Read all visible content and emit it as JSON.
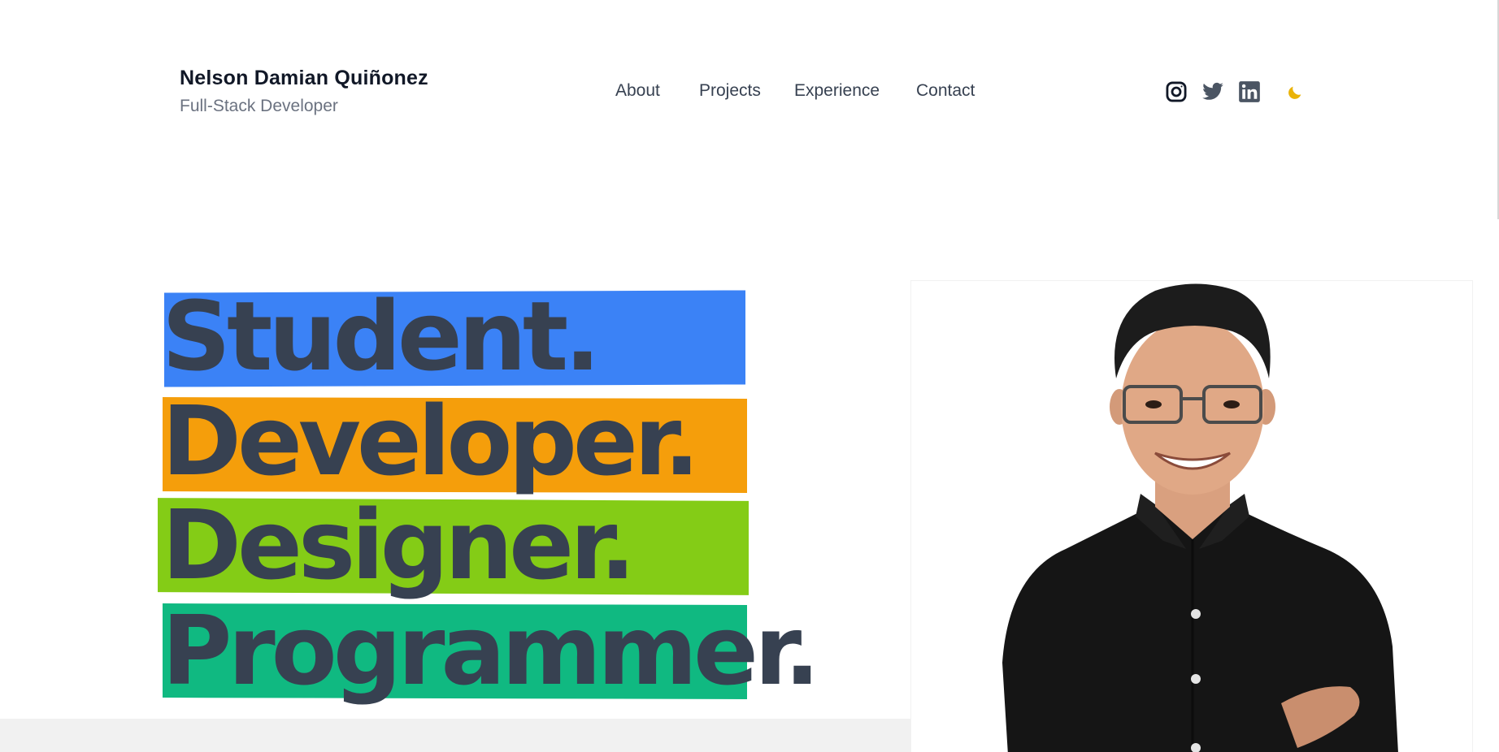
{
  "brand": {
    "name": "Nelson Damian Quiñonez",
    "role": "Full-Stack Developer"
  },
  "nav": {
    "items": [
      {
        "label": "About"
      },
      {
        "label": "Projects"
      },
      {
        "label": "Experience"
      },
      {
        "label": "Contact"
      }
    ]
  },
  "socials": [
    {
      "icon": "instagram-icon",
      "color": "#111827"
    },
    {
      "icon": "twitter-icon",
      "color": "#4b5563"
    },
    {
      "icon": "linkedin-icon",
      "color": "#4b5563"
    }
  ],
  "theme_toggle": {
    "icon": "moon-icon",
    "color": "#eab308"
  },
  "hero": {
    "words": [
      {
        "text": "Student.",
        "highlight": "#3b82f6"
      },
      {
        "text": "Developer.",
        "highlight": "#f59e0b"
      },
      {
        "text": "Designer.",
        "highlight": "#84cc16"
      },
      {
        "text": "Programmer.",
        "highlight": "#10b981"
      }
    ],
    "text_color": "#374151"
  },
  "portrait": {
    "alt": "portrait-photo"
  }
}
